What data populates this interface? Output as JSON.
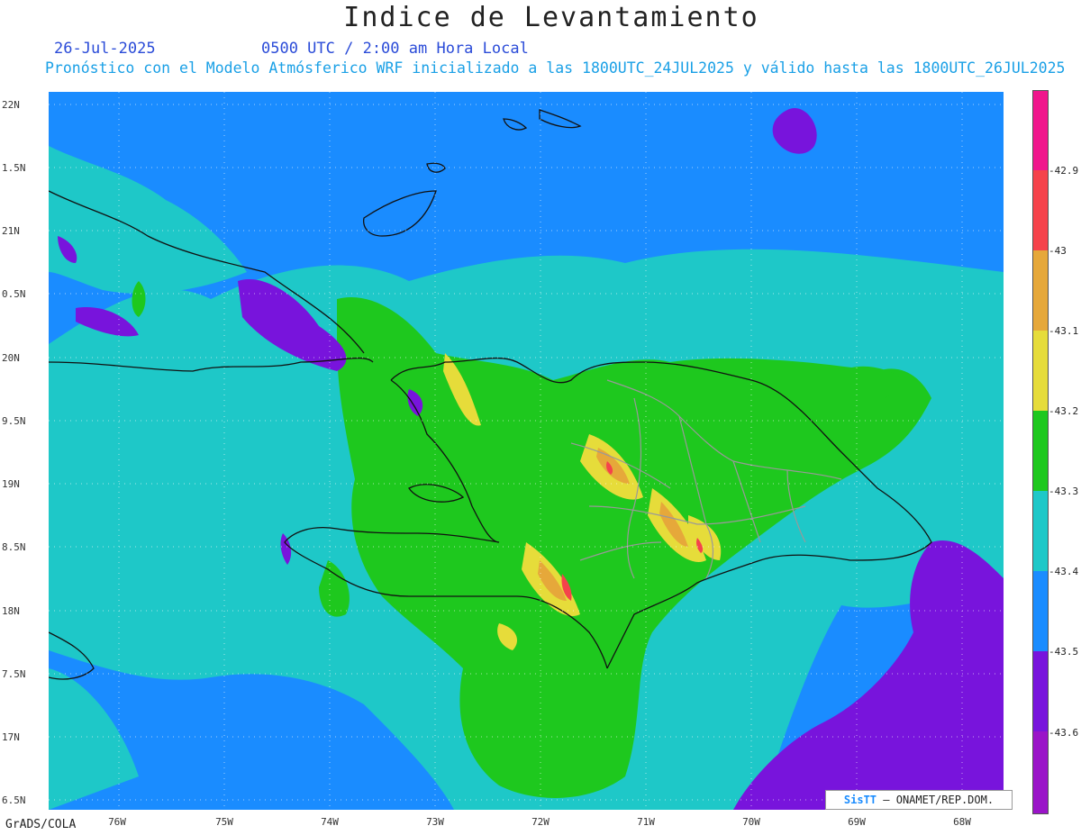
{
  "title": "Indice de Levantamiento",
  "date": "26-Jul-2025",
  "valid_time": "0500 UTC / 2:00 am Hora Local",
  "subtitle": "Pronóstico con el Modelo Atmósferico WRF inicializado a las 1800UTC_24JUL2025 y válido hasta las  1800UTC_26JUL2025",
  "footer": "GrADS/COLA",
  "credit": {
    "sis": "SisTT",
    "rest": "– ONAMET/REP.DOM."
  },
  "lat_labels": [
    "22N",
    "1.5N",
    "21N",
    "0.5N",
    "20N",
    "9.5N",
    "19N",
    "8.5N",
    "18N",
    "7.5N",
    "17N",
    "6.5N"
  ],
  "lon_labels": [
    "76W",
    "75W",
    "74W",
    "73W",
    "72W",
    "71W",
    "70W",
    "69W",
    "68W"
  ],
  "colorbar": {
    "colors": [
      "#f0168c",
      "#f5434b",
      "#e6a83a",
      "#e6dc3a",
      "#1ec81e",
      "#1ec8c8",
      "#1a8cff",
      "#7814dc",
      "#9a14c8"
    ],
    "labels": [
      "-42.9",
      "-43",
      "-43.1",
      "-43.2",
      "-43.3",
      "-43.4",
      "-43.5",
      "-43.6"
    ]
  }
}
